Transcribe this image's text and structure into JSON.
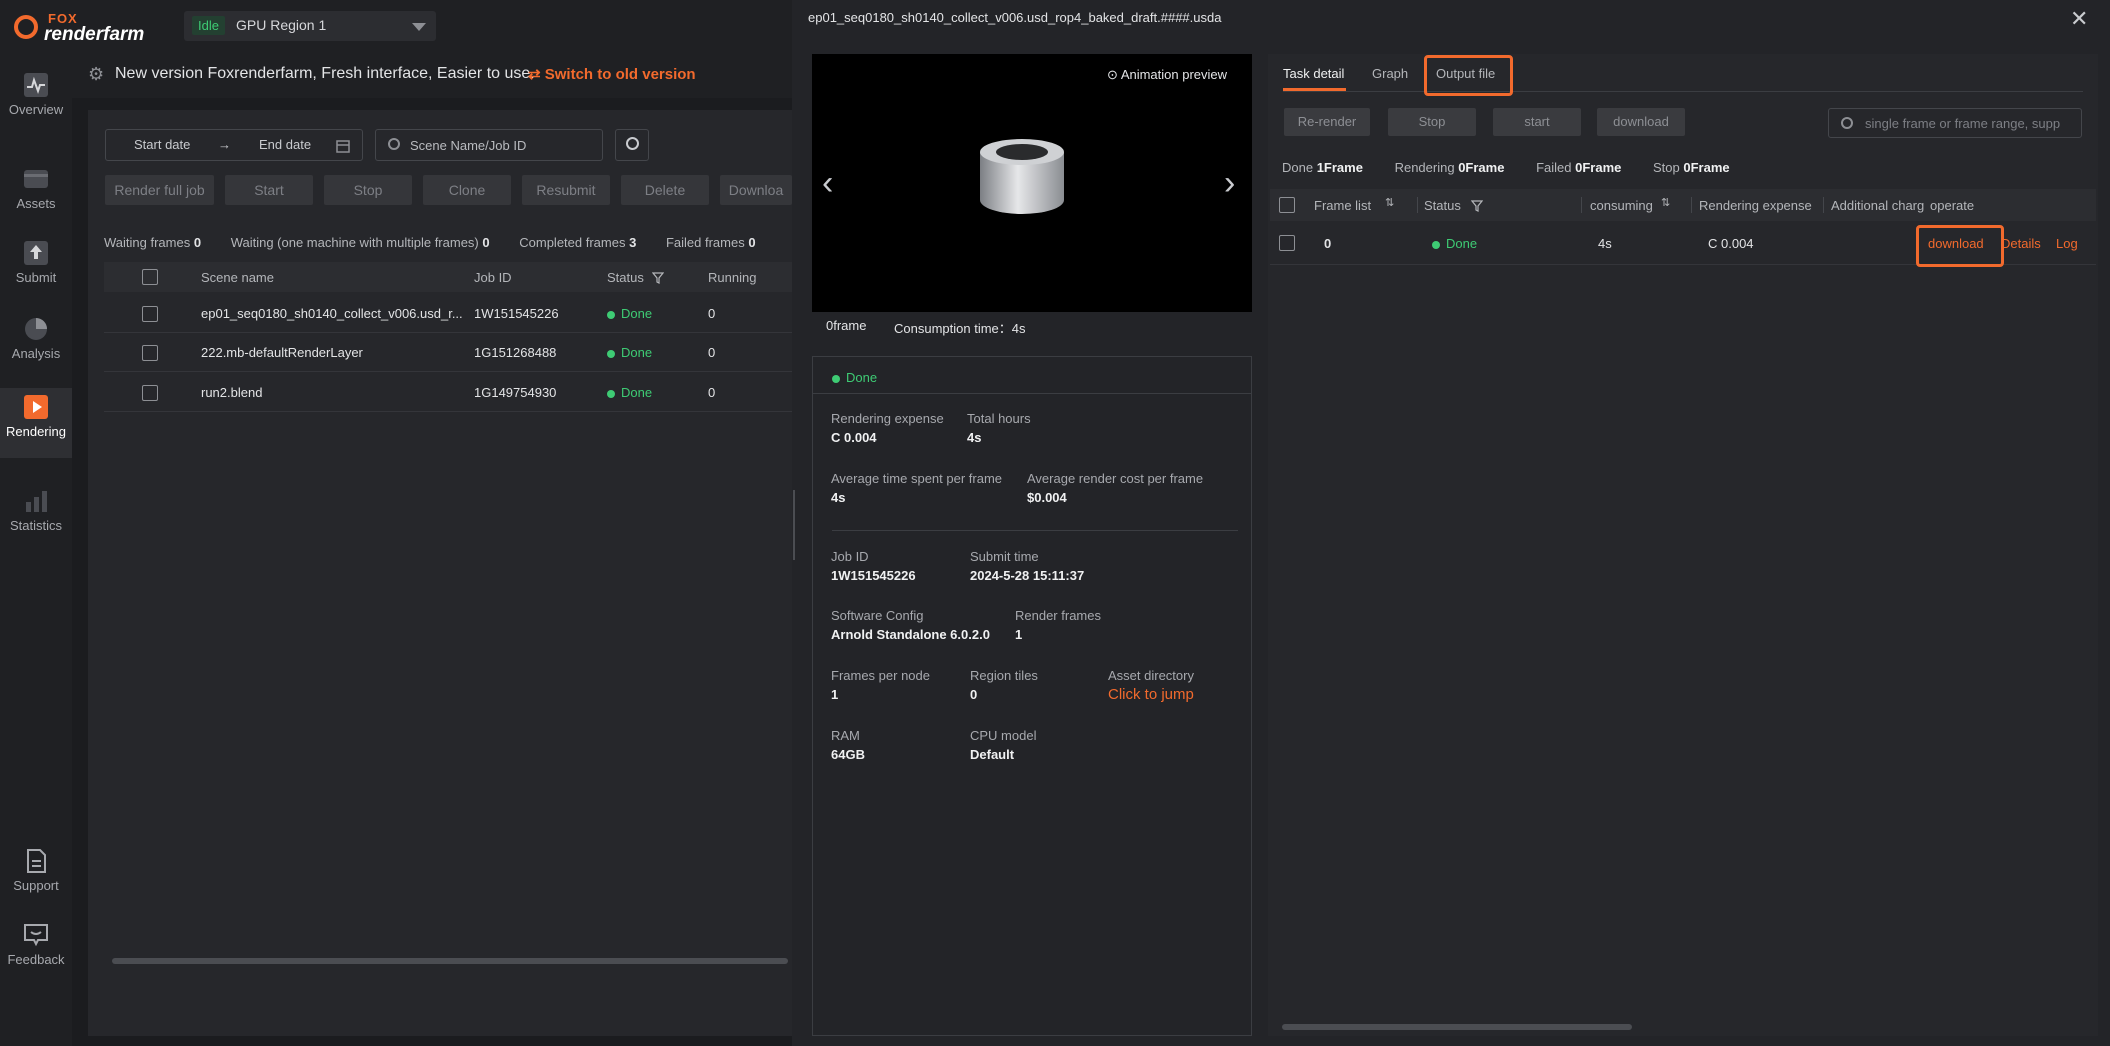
{
  "app": {
    "brand_top": "FOX",
    "brand_bottom": "renderfarm"
  },
  "region": {
    "status": "Idle",
    "name": "GPU Region 1"
  },
  "sidebar": {
    "items": [
      {
        "label": "Overview",
        "icon": "pulse-icon"
      },
      {
        "label": "Assets",
        "icon": "folder-icon"
      },
      {
        "label": "Submit",
        "icon": "upload-icon"
      },
      {
        "label": "Analysis",
        "icon": "pie-icon"
      },
      {
        "label": "Rendering",
        "icon": "play-icon"
      },
      {
        "label": "Statistics",
        "icon": "bar-chart-icon"
      },
      {
        "label": "Support",
        "icon": "document-icon"
      },
      {
        "label": "Feedback",
        "icon": "feedback-icon"
      }
    ]
  },
  "banner": {
    "message": "New version Foxrenderfarm, Fresh interface, Easier to use.",
    "switch_label": "Switch to old version"
  },
  "filters": {
    "start_date": "Start date",
    "arrow": "→",
    "end_date": "End date",
    "search_placeholder": "Scene Name/Job ID"
  },
  "toolbar": [
    "Render full job",
    "Start",
    "Stop",
    "Clone",
    "Resubmit",
    "Delete",
    "Downloa"
  ],
  "job_stats": [
    {
      "label": "Waiting frames",
      "value": "0"
    },
    {
      "label": "Waiting (one machine with multiple frames)",
      "value": "0"
    },
    {
      "label": "Completed frames",
      "value": "3"
    },
    {
      "label": "Failed frames",
      "value": "0"
    }
  ],
  "job_table": {
    "headers": {
      "scene": "Scene name",
      "job": "Job ID",
      "status": "Status",
      "running": "Running"
    },
    "rows": [
      {
        "scene": "ep01_seq0180_sh0140_collect_v006.usd_r...",
        "job": "1W151545226",
        "status": "Done",
        "running": "0"
      },
      {
        "scene": "222.mb-defaultRenderLayer",
        "job": "1G151268488",
        "status": "Done",
        "running": "0"
      },
      {
        "scene": "run2.blend",
        "job": "1G149754930",
        "status": "Done",
        "running": "0"
      }
    ]
  },
  "dialog": {
    "title": "ep01_seq0180_sh0140_collect_v006.usd_rop4_baked_draft.####.usda",
    "close": "✕",
    "preview": {
      "anim_label": "Animation preview",
      "frame": "0frame",
      "consumption": "Consumption time：4s"
    },
    "status": "Done",
    "info": {
      "rendering_expense_label": "Rendering expense",
      "rendering_expense": "C 0.004",
      "total_hours_label": "Total hours",
      "total_hours": "4s",
      "avg_time_label": "Average time spent per frame",
      "avg_time": "4s",
      "avg_cost_label": "Average render cost per frame",
      "avg_cost": "$0.004",
      "job_id_label": "Job ID",
      "job_id": "1W151545226",
      "submit_time_label": "Submit time",
      "submit_time": "2024-5-28 15:11:37",
      "software_label": "Software Config",
      "software": "Arnold Standalone 6.0.2.0",
      "render_frames_label": "Render frames",
      "render_frames": "1",
      "frames_node_label": "Frames per node",
      "frames_node": "1",
      "region_tiles_label": "Region tiles",
      "region_tiles": "0",
      "asset_dir_label": "Asset directory",
      "asset_dir_link": "Click to jump",
      "ram_label": "RAM",
      "ram": "64GB",
      "cpu_label": "CPU model",
      "cpu": "Default"
    },
    "tabs": [
      "Task detail",
      "Graph",
      "Output file"
    ],
    "actions": [
      "Re-render",
      "Stop",
      "start",
      "download"
    ],
    "frame_search_placeholder": "single frame or frame range, supp",
    "frame_stats": [
      {
        "label": "Done",
        "value": "1Frame"
      },
      {
        "label": "Rendering",
        "value": "0Frame"
      },
      {
        "label": "Failed",
        "value": "0Frame"
      },
      {
        "label": "Stop",
        "value": "0Frame"
      }
    ],
    "frame_table": {
      "headers": {
        "frame": "Frame list",
        "status": "Status",
        "consuming": "consuming",
        "expense": "Rendering expense",
        "additional": "Additional charg",
        "operate": "operate"
      },
      "row": {
        "frame": "0",
        "status": "Done",
        "consuming": "4s",
        "expense": "C 0.004",
        "download": "download",
        "details": "Details",
        "log": "Log"
      }
    }
  },
  "colors": {
    "accent": "#f26a2d",
    "success": "#3ecb74"
  }
}
